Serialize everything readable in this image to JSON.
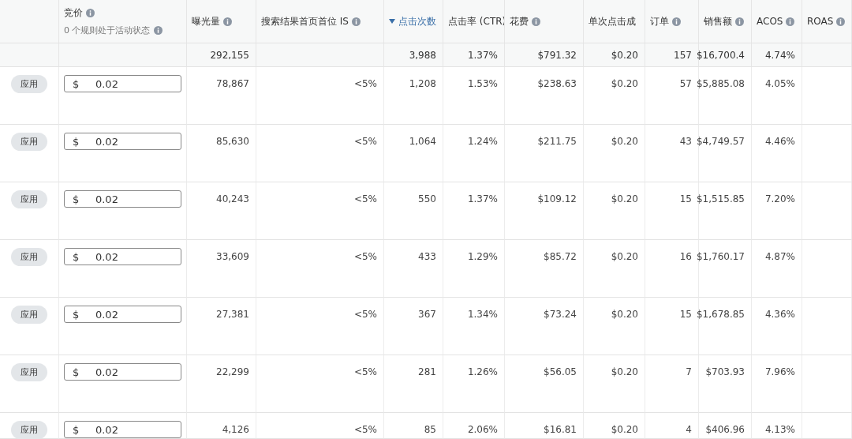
{
  "table": {
    "columns": [
      {
        "info": false,
        "sorted": false
      },
      {
        "label": "竞价",
        "info": true,
        "sorted": false,
        "subtitle": "0 个规则处于活动状态"
      },
      {
        "label": "曝光量",
        "info": true,
        "sorted": false
      },
      {
        "label": "搜索结果首页首位 IS",
        "info": true,
        "sorted": false
      },
      {
        "label": "点击次数",
        "info": false,
        "sorted": true
      },
      {
        "label": "点击率 (CTR)",
        "info": false,
        "sorted": false
      },
      {
        "label": "花费",
        "info": true,
        "sorted": false
      },
      {
        "label": "单次点击成",
        "info": false,
        "sorted": false
      },
      {
        "label": "订单",
        "info": true,
        "sorted": false
      },
      {
        "label": "销售额",
        "info": true,
        "sorted": false
      },
      {
        "label": "ACOS",
        "info": true,
        "sorted": false
      },
      {
        "label": "ROAS",
        "info": true,
        "sorted": false
      }
    ],
    "totals": {
      "cells": [
        null,
        null,
        "292,155",
        null,
        "3,988",
        "1.37%",
        "$791.32",
        "$0.20",
        "157",
        "$16,700.4",
        "4.74%",
        null
      ]
    },
    "rows": [
      {
        "cells": [
          {
            "kind": "button",
            "text": "应用"
          },
          {
            "kind": "input",
            "currency": "$",
            "value": "0.02"
          },
          "78,867",
          "<5%",
          "1,208",
          "1.53%",
          "$238.63",
          "$0.20",
          "57",
          "$5,885.08",
          "4.05%",
          null
        ]
      },
      {
        "cells": [
          {
            "kind": "button",
            "text": "应用"
          },
          {
            "kind": "input",
            "currency": "$",
            "value": "0.02"
          },
          "85,630",
          "<5%",
          "1,064",
          "1.24%",
          "$211.75",
          "$0.20",
          "43",
          "$4,749.57",
          "4.46%",
          null
        ]
      },
      {
        "cells": [
          {
            "kind": "button",
            "text": "应用"
          },
          {
            "kind": "input",
            "currency": "$",
            "value": "0.02"
          },
          "40,243",
          "<5%",
          "550",
          "1.37%",
          "$109.12",
          "$0.20",
          "15",
          "$1,515.85",
          "7.20%",
          null
        ]
      },
      {
        "cells": [
          {
            "kind": "button",
            "text": "应用"
          },
          {
            "kind": "input",
            "currency": "$",
            "value": "0.02"
          },
          "33,609",
          "<5%",
          "433",
          "1.29%",
          "$85.72",
          "$0.20",
          "16",
          "$1,760.17",
          "4.87%",
          null
        ]
      },
      {
        "cells": [
          {
            "kind": "button",
            "text": "应用"
          },
          {
            "kind": "input",
            "currency": "$",
            "value": "0.02"
          },
          "27,381",
          "<5%",
          "367",
          "1.34%",
          "$73.24",
          "$0.20",
          "15",
          "$1,678.85",
          "4.36%",
          null
        ]
      },
      {
        "cells": [
          {
            "kind": "button",
            "text": "应用"
          },
          {
            "kind": "input",
            "currency": "$",
            "value": "0.02"
          },
          "22,299",
          "<5%",
          "281",
          "1.26%",
          "$56.05",
          "$0.20",
          "7",
          "$703.93",
          "7.96%",
          null
        ]
      },
      {
        "cells": [
          {
            "kind": "button",
            "text": "应用"
          },
          {
            "kind": "input",
            "currency": "$",
            "value": "0.02"
          },
          "4,126",
          "<5%",
          "85",
          "2.06%",
          "$16.81",
          "$0.20",
          "4",
          "$406.96",
          "4.13%",
          null
        ]
      }
    ]
  }
}
